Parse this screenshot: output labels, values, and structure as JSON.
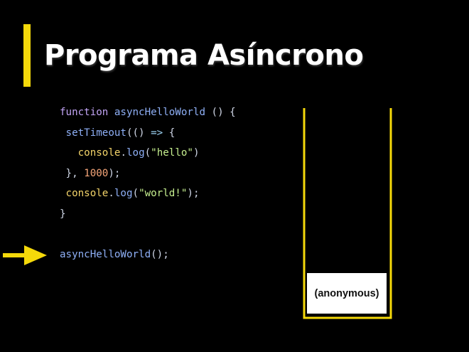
{
  "slide": {
    "title": "Programa Asíncrono",
    "accent_color": "#f5d90a",
    "background_color": "#000000"
  },
  "code": {
    "lines": [
      {
        "indent": 0,
        "tokens": [
          {
            "t": "kw",
            "v": "function "
          },
          {
            "t": "fn",
            "v": "asyncHelloWorld"
          },
          {
            "t": "pl",
            "v": " () {"
          }
        ]
      },
      {
        "indent": 1,
        "tokens": [
          {
            "t": "fn",
            "v": "setTimeout"
          },
          {
            "t": "pl",
            "v": "(() "
          },
          {
            "t": "arrow",
            "v": "=>"
          },
          {
            "t": "pl",
            "v": " {"
          }
        ]
      },
      {
        "indent": 3,
        "tokens": [
          {
            "t": "obj",
            "v": "console"
          },
          {
            "t": "pl",
            "v": "."
          },
          {
            "t": "fn",
            "v": "log"
          },
          {
            "t": "pl",
            "v": "("
          },
          {
            "t": "str",
            "v": "\"hello\""
          },
          {
            "t": "pl",
            "v": ")"
          }
        ]
      },
      {
        "indent": 1,
        "tokens": [
          {
            "t": "pl",
            "v": "}, "
          },
          {
            "t": "num",
            "v": "1000"
          },
          {
            "t": "pl",
            "v": ");"
          }
        ]
      },
      {
        "indent": 1,
        "tokens": [
          {
            "t": "obj",
            "v": "console"
          },
          {
            "t": "pl",
            "v": "."
          },
          {
            "t": "fn",
            "v": "log"
          },
          {
            "t": "pl",
            "v": "("
          },
          {
            "t": "str",
            "v": "\"world!\""
          },
          {
            "t": "pl",
            "v": ");"
          }
        ]
      },
      {
        "indent": 0,
        "tokens": [
          {
            "t": "pl",
            "v": "}"
          }
        ]
      },
      {
        "indent": 0,
        "tokens": []
      },
      {
        "indent": 0,
        "tokens": [
          {
            "t": "fn",
            "v": "asyncHelloWorld"
          },
          {
            "t": "pl",
            "v": "();"
          }
        ]
      }
    ],
    "current_line": 8,
    "pointer_icon": "arrow-right-icon"
  },
  "call_stack": {
    "frames": [
      {
        "label": "(anonymous)"
      }
    ]
  }
}
